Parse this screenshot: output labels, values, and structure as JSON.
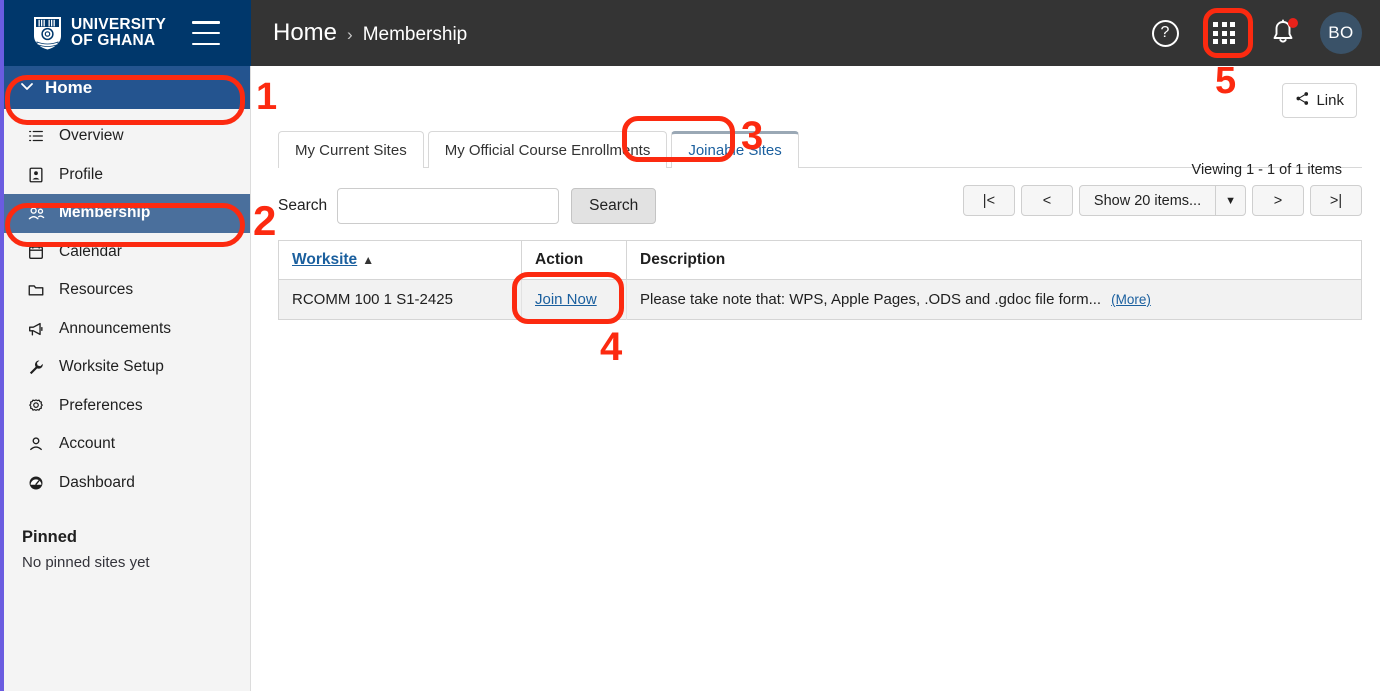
{
  "header": {
    "university_line1": "UNIVERSITY",
    "university_line2": "OF GHANA",
    "breadcrumb_home": "Home",
    "breadcrumb_sep": "›",
    "breadcrumb_current": "Membership",
    "help_glyph": "?",
    "avatar_initials": "BO"
  },
  "sidebar": {
    "home_label": "Home",
    "home_chevron": "⌄",
    "items": [
      {
        "label": "Overview",
        "icon": "list-icon",
        "active": false
      },
      {
        "label": "Profile",
        "icon": "id-card-icon",
        "active": false
      },
      {
        "label": "Membership",
        "icon": "people-icon",
        "active": true
      },
      {
        "label": "Calendar",
        "icon": "calendar-icon",
        "active": false
      },
      {
        "label": "Resources",
        "icon": "folder-icon",
        "active": false
      },
      {
        "label": "Announcements",
        "icon": "megaphone-icon",
        "active": false
      },
      {
        "label": "Worksite Setup",
        "icon": "wrench-icon",
        "active": false
      },
      {
        "label": "Preferences",
        "icon": "gear-icon",
        "active": false
      },
      {
        "label": "Account",
        "icon": "person-icon",
        "active": false
      },
      {
        "label": "Dashboard",
        "icon": "gauge-icon",
        "active": false
      }
    ],
    "pinned_title": "Pinned",
    "pinned_empty": "No pinned sites yet"
  },
  "main": {
    "link_button": "Link",
    "tabs": [
      {
        "label": "My Current Sites",
        "active": false
      },
      {
        "label": "My Official Course Enrollments",
        "active": false
      },
      {
        "label": "Joinable Sites",
        "active": true
      }
    ],
    "search": {
      "label": "Search",
      "value": "",
      "placeholder": "",
      "button": "Search"
    },
    "pager": {
      "count_text": "Viewing 1 - 1 of 1 items",
      "first": "|<",
      "prev": "<",
      "page_size": "Show 20 items...",
      "next": ">",
      "last": ">|"
    },
    "table": {
      "columns": [
        "Worksite",
        "Action",
        "Description"
      ],
      "sort_glyph": "▲",
      "rows": [
        {
          "worksite": "RCOMM 100 1 S1-2425",
          "action": "Join Now",
          "description": "Please take note that: WPS, Apple Pages, .ODS and .gdoc file form...",
          "more": "(More)"
        }
      ]
    }
  },
  "annotations": {
    "accent_color": "#fc2a10",
    "marks": [
      {
        "number": "1",
        "target": "sidebar-home"
      },
      {
        "number": "2",
        "target": "sidebar-membership"
      },
      {
        "number": "3",
        "target": "tab-joinable-sites"
      },
      {
        "number": "4",
        "target": "join-now-link"
      },
      {
        "number": "5",
        "target": "app-grid-icon"
      }
    ]
  }
}
